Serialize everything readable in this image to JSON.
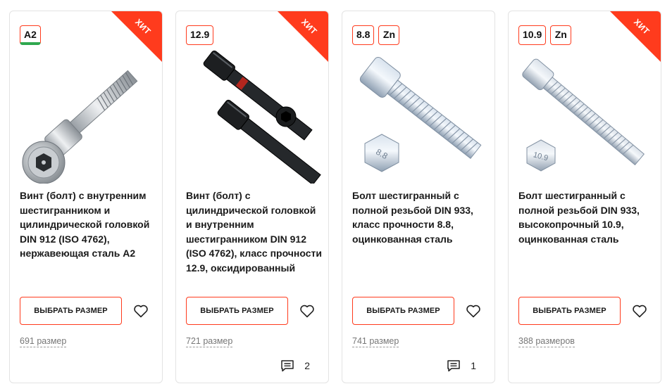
{
  "colors": {
    "accent": "#ff3b1d",
    "green_marker": "#2fa84f"
  },
  "products": [
    {
      "hit_label": "ХИТ",
      "badges": [
        "A2"
      ],
      "title": "Винт (болт) с внутренним шестигранником и цилиндрической головкой DIN 912 (ISO 4762), нержавеющая сталь А2",
      "button_label": "ВЫБРАТЬ РАЗМЕР",
      "sizes_text": "691 размер",
      "reviews_count": null,
      "image": "stainless-socket-head-cap-screw"
    },
    {
      "hit_label": "ХИТ",
      "badges": [
        "12.9"
      ],
      "title": "Винт (болт) с цилиндрической головкой и внутренним шестигранником DIN 912 (ISO 4762), класс прочности 12.9, оксидированный",
      "button_label": "ВЫБРАТЬ РАЗМЕР",
      "sizes_text": "721 размер",
      "reviews_count": "2",
      "image": "black-oxide-socket-head-cap-screw"
    },
    {
      "hit_label": null,
      "badges": [
        "8.8",
        "Zn"
      ],
      "title": "Болт шестигранный с полной резьбой DIN 933, класс прочности 8.8, оцинкованная сталь",
      "button_label": "ВЫБРАТЬ РАЗМЕР",
      "sizes_text": "741 размер",
      "reviews_count": "1",
      "image": "zinc-hex-bolt-8-8",
      "head_mark": "8.8"
    },
    {
      "hit_label": "ХИТ",
      "badges": [
        "10.9",
        "Zn"
      ],
      "title": "Болт шестигранный с полной резьбой DIN 933, высокопрочный 10.9, оцинкованная сталь",
      "button_label": "ВЫБРАТЬ РАЗМЕР",
      "sizes_text": "388 размеров",
      "reviews_count": null,
      "image": "zinc-hex-bolt-10-9",
      "head_mark": "10.9"
    }
  ]
}
